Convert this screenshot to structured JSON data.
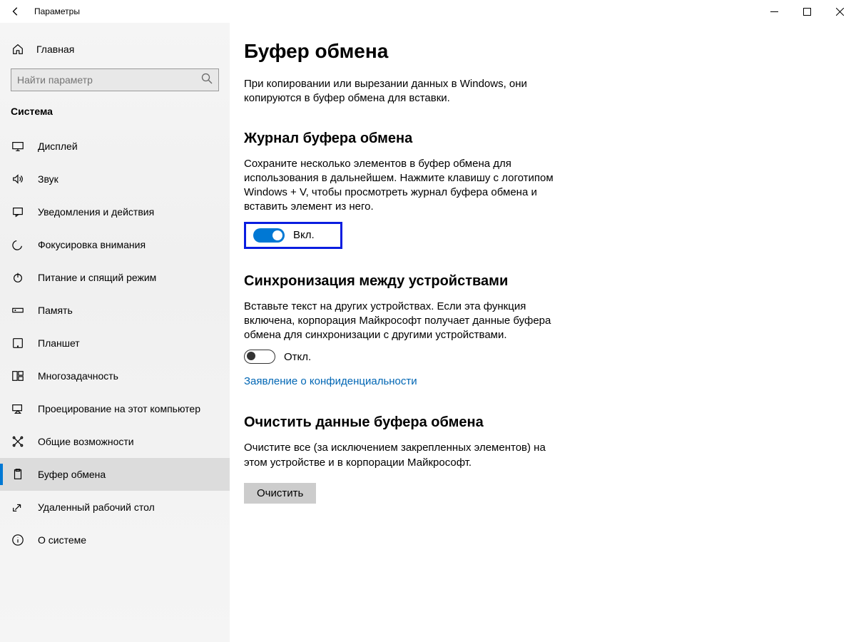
{
  "titlebar": {
    "title": "Параметры"
  },
  "sidebar": {
    "home": "Главная",
    "search_placeholder": "Найти параметр",
    "section": "Система",
    "items": [
      {
        "label": "Дисплей"
      },
      {
        "label": "Звук"
      },
      {
        "label": "Уведомления и действия"
      },
      {
        "label": "Фокусировка внимания"
      },
      {
        "label": "Питание и спящий режим"
      },
      {
        "label": "Память"
      },
      {
        "label": "Планшет"
      },
      {
        "label": "Многозадачность"
      },
      {
        "label": "Проецирование на этот компьютер"
      },
      {
        "label": "Общие возможности"
      },
      {
        "label": "Буфер обмена"
      },
      {
        "label": "Удаленный рабочий стол"
      },
      {
        "label": "О системе"
      }
    ]
  },
  "main": {
    "title": "Буфер обмена",
    "intro": "При копировании или вырезании данных в Windows, они копируются в буфер обмена для вставки.",
    "history": {
      "title": "Журнал буфера обмена",
      "desc": "Сохраните несколько элементов в буфер обмена для использования в дальнейшем. Нажмите клавишу с логотипом Windows + V, чтобы просмотреть журнал буфера обмена и вставить элемент из него.",
      "state": "Вкл."
    },
    "sync": {
      "title": "Синхронизация между устройствами",
      "desc": "Вставьте текст на других устройствах. Если эта функция включена, корпорация Майкрософт получает данные буфера обмена для синхронизации с другими устройствами.",
      "state": "Откл.",
      "privacy_link": "Заявление о конфиденциальности"
    },
    "clear": {
      "title": "Очистить данные буфера обмена",
      "desc": "Очистите все (за исключением закрепленных элементов) на этом устройстве и в корпорации Майкрософт.",
      "button": "Очистить"
    }
  }
}
